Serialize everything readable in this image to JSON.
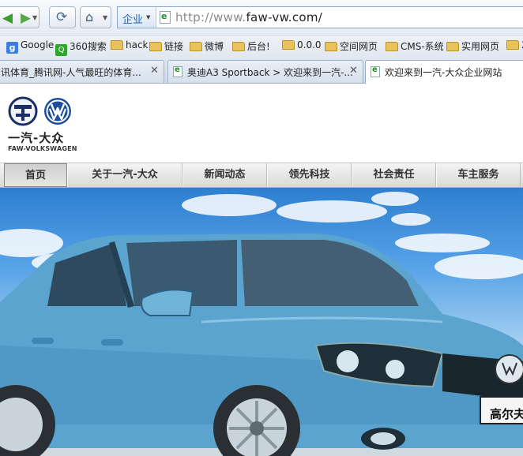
{
  "browser": {
    "search_engine_label": "企业",
    "url_prefix": "http://www.",
    "url_domain": "faw-vw.com/"
  },
  "bookmarks": [
    {
      "label": "Google",
      "icon": "google-icon"
    },
    {
      "label": "360搜索",
      "icon": "360-search-icon"
    },
    {
      "label": "hack",
      "icon": "folder-icon"
    },
    {
      "label": "链接",
      "icon": "folder-icon"
    },
    {
      "label": "微博",
      "icon": "folder-icon"
    },
    {
      "label": "后台!",
      "icon": "folder-icon"
    },
    {
      "label": "0.0.0",
      "icon": "folder-icon"
    },
    {
      "label": "空间网页",
      "icon": "folder-icon"
    },
    {
      "label": "CMS-系统",
      "icon": "folder-icon"
    },
    {
      "label": "实用网页",
      "icon": "folder-icon"
    },
    {
      "label": "2",
      "icon": "folder-icon"
    }
  ],
  "tabs": [
    {
      "label": "讯体育_腾讯网-人气最旺的体育...",
      "active": false
    },
    {
      "label": "奥迪A3 Sportback > 欢迎来到一汽-...",
      "active": false
    },
    {
      "label": "欢迎来到一汽-大众企业网站",
      "active": true
    }
  ],
  "site": {
    "logo_cn": "一汽-大众",
    "logo_en": "FAW-VOLKSWAGEN",
    "nav": [
      "首页",
      "关于一汽-大众",
      "新闻动态",
      "领先科技",
      "社会责任",
      "车主服务"
    ],
    "hero_plate_text": "高尔夫"
  },
  "colors": {
    "car_body": "#5aa4cf",
    "sky": "#4f97dd",
    "url_border": "#8fa7c7"
  }
}
